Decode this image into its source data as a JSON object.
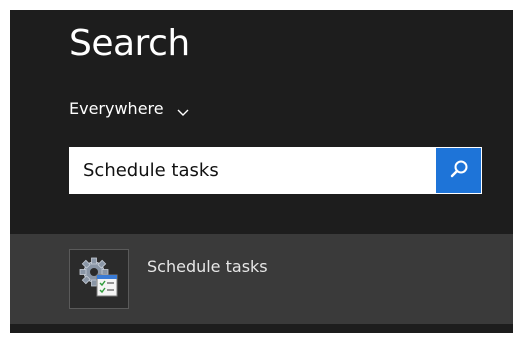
{
  "header": {
    "title": "Search"
  },
  "scope": {
    "label": "Everywhere",
    "icon": "chevron-down-icon"
  },
  "search": {
    "value": "Schedule tasks",
    "button_icon": "search-icon"
  },
  "results": [
    {
      "label": "Schedule tasks",
      "icon": "task-scheduler-icon"
    }
  ],
  "colors": {
    "background": "#1d1d1d",
    "result_highlight": "#3a3a3a",
    "accent": "#1e74d8",
    "text": "#ffffff"
  }
}
